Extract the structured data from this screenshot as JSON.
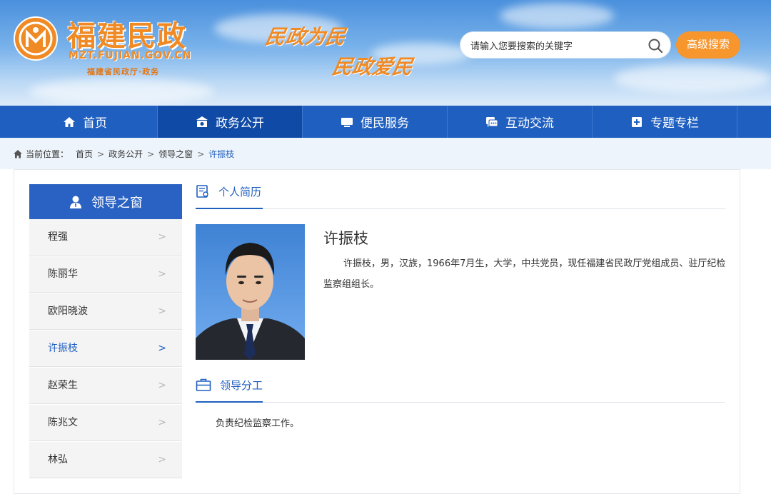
{
  "header": {
    "logo_title": "福建民政",
    "logo_domain": "MZT.FUJIAN.GOV.CN",
    "logo_sub": "福建省民政厅·政务",
    "slogan_1": "民政为民",
    "slogan_2": "民政爱民",
    "search_placeholder": "请输入您要搜索的关键字",
    "advanced_search_label": "高级搜索"
  },
  "nav": {
    "items": [
      {
        "label": "首页",
        "icon": "home-icon"
      },
      {
        "label": "政务公开",
        "icon": "government-icon"
      },
      {
        "label": "便民服务",
        "icon": "monitor-icon"
      },
      {
        "label": "互动交流",
        "icon": "chat-icon"
      },
      {
        "label": "专题专栏",
        "icon": "bookmark-plus-icon"
      }
    ],
    "active_index": 1
  },
  "breadcrumb": {
    "prefix": "当前位置：",
    "items": [
      "首页",
      "政务公开",
      "领导之窗"
    ],
    "current": "许振枝"
  },
  "sidebar": {
    "title": "领导之窗",
    "items": [
      {
        "label": "程强"
      },
      {
        "label": "陈丽华"
      },
      {
        "label": "欧阳晓波"
      },
      {
        "label": "许振枝"
      },
      {
        "label": "赵荣生"
      },
      {
        "label": "陈兆文"
      },
      {
        "label": "林弘"
      }
    ],
    "active_index": 3
  },
  "profile": {
    "section_title": "个人简历",
    "name": "许振枝",
    "bio": "许振枝，男，汉族，1966年7月生，大学，中共党员，现任福建省民政厅党组成员、驻厅纪检监察组组长。"
  },
  "duties": {
    "section_title": "领导分工",
    "text": "负责纪检监察工作。"
  },
  "colors": {
    "nav_blue": "#1f5fc0",
    "accent_orange": "#f7962c"
  }
}
